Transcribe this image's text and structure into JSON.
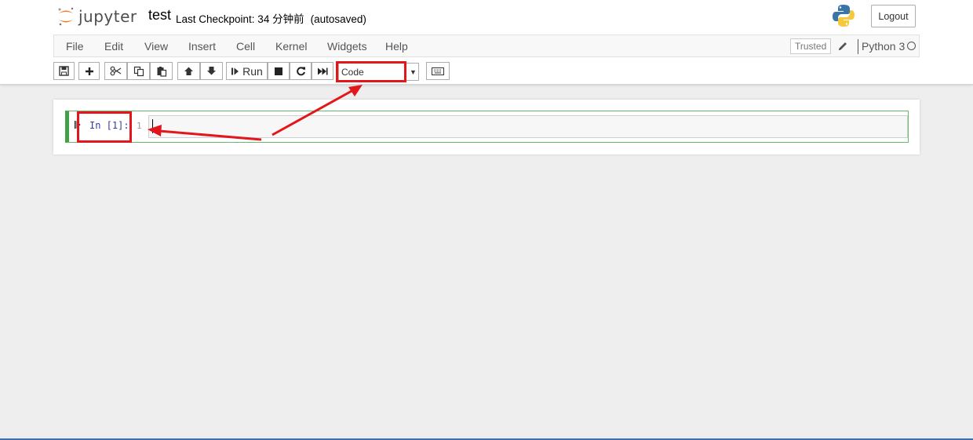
{
  "header": {
    "logo_text": "jupyter",
    "notebook_name": "test",
    "checkpoint": "Last Checkpoint: 34 分钟前",
    "autosave": "(autosaved)",
    "logout_label": "Logout"
  },
  "menubar": {
    "items": [
      "File",
      "Edit",
      "View",
      "Insert",
      "Cell",
      "Kernel",
      "Widgets",
      "Help"
    ],
    "trusted_label": "Trusted",
    "kernel_name": "Python 3"
  },
  "toolbar": {
    "buttons": [
      "save-icon",
      "plus-icon",
      "scissors-icon",
      "copy-icon",
      "paste-icon",
      "arrow-up-icon",
      "arrow-down-icon",
      "run",
      "stop-icon",
      "restart-icon",
      "fast-forward-icon",
      "keyboard-icon"
    ],
    "run_label": "Run",
    "cell_type": "Code"
  },
  "cell": {
    "prompt": "In [1]:",
    "line_number": "1",
    "content": ""
  },
  "colors": {
    "accent_green": "#42a045",
    "annotation_red": "#e3161b",
    "prompt_blue": "#303f9f",
    "jupyter_orange": "#f37726"
  }
}
